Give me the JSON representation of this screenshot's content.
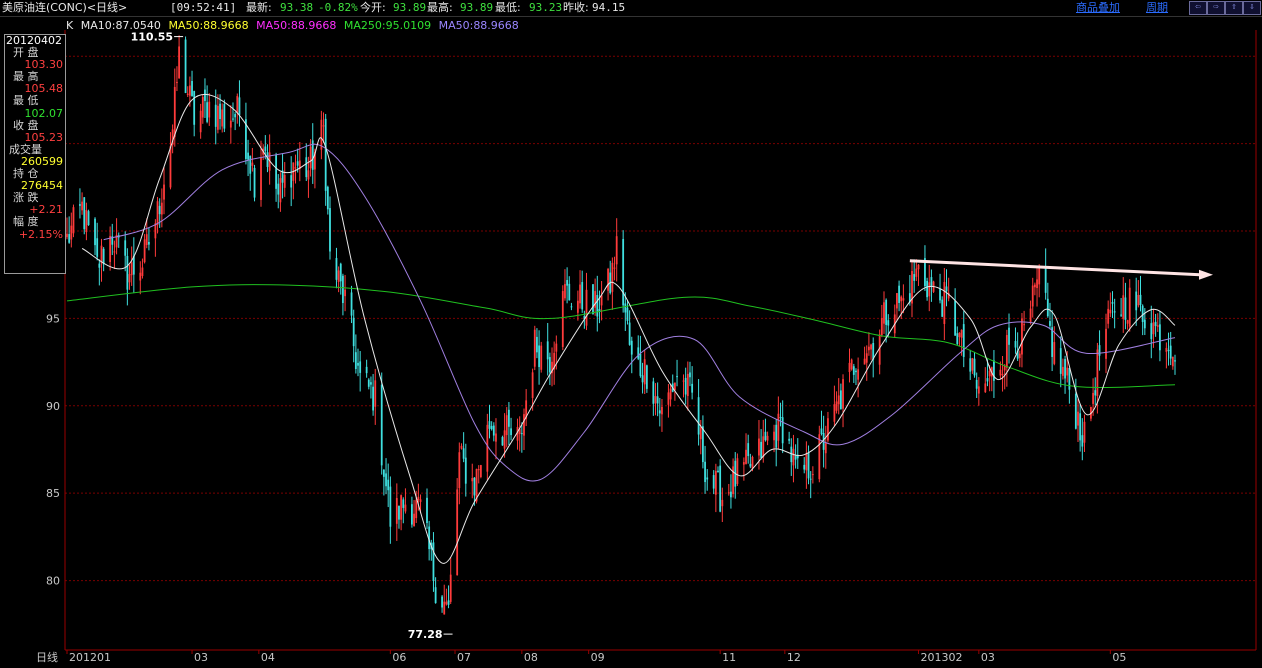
{
  "header": {
    "title": "美原油连(CONC)<日线>",
    "time": "[09:52:41]",
    "latest_label": "最新:",
    "latest_value": "93.38",
    "change": "-0.82%",
    "open_label": "今开:",
    "open_value": "93.89",
    "high_label": "最高:",
    "high_value": "93.89",
    "low_label": "最低:",
    "low_value": "93.23",
    "prev_label": "昨收:",
    "prev_value": "94.15",
    "overlay_link": "商品叠加",
    "period_link": "周期",
    "nav_buttons": [
      "⇦",
      "⇨",
      "⇧",
      "⇩"
    ]
  },
  "legend": {
    "k_label": "K",
    "ma10": "MA10:87.0540",
    "ma50a": "MA50:88.9668",
    "ma50b": "MA50:88.9668",
    "ma250": "MA250:95.0109",
    "ma50c": "MA50:88.9668"
  },
  "infobox": {
    "date": "20120402",
    "open_label": "开  盘",
    "open": "103.30",
    "high_label": "最  高",
    "high": "105.48",
    "low_label": "最  低",
    "low": "102.07",
    "close_label": "收  盘",
    "close": "105.23",
    "volume_label": "成交量",
    "volume": "260599",
    "oi_label": "持  仓",
    "oi": "276454",
    "chg_label": "涨  跌",
    "chg": "+2.21",
    "amp_label": "幅  度",
    "amp": "+2.15%"
  },
  "colors": {
    "up": "#ff3b3b",
    "down": "#3fe0e0",
    "ma10": "#e8e8e8",
    "ma50": "#a07fe0",
    "ma250": "#20c020",
    "grid": "#7a0000",
    "axis": "#9a0000",
    "trend": "#ffe4e4"
  },
  "chart_data": {
    "type": "line",
    "ylim": [
      77,
      111.5
    ],
    "yticks": [
      80,
      85,
      90,
      95
    ],
    "xlabel_prefix": "日线",
    "xticks": [
      "201201",
      "03",
      "04",
      "06",
      "07",
      "08",
      "09",
      "11",
      "12",
      "201302",
      "03",
      "05"
    ],
    "xtick_months": [
      "2012-01",
      "2012-03",
      "2012-04",
      "2012-06",
      "2012-07",
      "2012-08",
      "2012-09",
      "2012-11",
      "2012-12",
      "2013-02",
      "2013-03",
      "2013-05"
    ],
    "annotations": [
      {
        "text": "110.55",
        "date": "2012-02-24",
        "value": 110.55
      },
      {
        "text": "77.28",
        "date": "2012-06-28",
        "value": 77.28
      }
    ],
    "trendline": {
      "from": [
        "2013-01-28",
        98.3
      ],
      "to": [
        "2013-05-31",
        97.5
      ]
    },
    "price_path": [
      [
        "2012-01-03",
        99.5
      ],
      [
        "2012-01-10",
        101.3
      ],
      [
        "2012-01-17",
        98.0
      ],
      [
        "2012-01-24",
        99.8
      ],
      [
        "2012-01-31",
        97.5
      ],
      [
        "2012-02-07",
        98.2
      ],
      [
        "2012-02-14",
        101.0
      ],
      [
        "2012-02-21",
        105.8
      ],
      [
        "2012-02-24",
        110.0
      ],
      [
        "2012-03-02",
        106.5
      ],
      [
        "2012-03-09",
        107.2
      ],
      [
        "2012-03-16",
        106.4
      ],
      [
        "2012-03-23",
        106.8
      ],
      [
        "2012-03-30",
        103.0
      ],
      [
        "2012-04-03",
        105.2
      ],
      [
        "2012-04-10",
        102.0
      ],
      [
        "2012-04-17",
        103.8
      ],
      [
        "2012-04-24",
        103.5
      ],
      [
        "2012-05-01",
        105.8
      ],
      [
        "2012-05-04",
        98.5
      ],
      [
        "2012-05-11",
        96.0
      ],
      [
        "2012-05-18",
        91.5
      ],
      [
        "2012-05-25",
        90.5
      ],
      [
        "2012-06-01",
        83.5
      ],
      [
        "2012-06-08",
        84.5
      ],
      [
        "2012-06-15",
        84.0
      ],
      [
        "2012-06-22",
        79.8
      ],
      [
        "2012-06-28",
        78.2
      ],
      [
        "2012-07-03",
        87.0
      ],
      [
        "2012-07-10",
        85.5
      ],
      [
        "2012-07-17",
        89.0
      ],
      [
        "2012-07-24",
        88.5
      ],
      [
        "2012-07-31",
        88.0
      ],
      [
        "2012-08-07",
        93.5
      ],
      [
        "2012-08-14",
        92.8
      ],
      [
        "2012-08-21",
        96.5
      ],
      [
        "2012-08-28",
        96.0
      ],
      [
        "2012-09-04",
        95.5
      ],
      [
        "2012-09-11",
        97.0
      ],
      [
        "2012-09-14",
        99.0
      ],
      [
        "2012-09-21",
        92.5
      ],
      [
        "2012-09-28",
        92.0
      ],
      [
        "2012-10-05",
        89.5
      ],
      [
        "2012-10-12",
        91.8
      ],
      [
        "2012-10-19",
        90.5
      ],
      [
        "2012-10-26",
        86.0
      ],
      [
        "2012-11-02",
        84.8
      ],
      [
        "2012-11-09",
        86.0
      ],
      [
        "2012-11-16",
        86.7
      ],
      [
        "2012-11-23",
        88.0
      ],
      [
        "2012-11-30",
        88.9
      ],
      [
        "2012-12-07",
        86.0
      ],
      [
        "2012-12-14",
        86.7
      ],
      [
        "2012-12-21",
        88.5
      ],
      [
        "2012-12-28",
        90.8
      ],
      [
        "2013-01-04",
        93.0
      ],
      [
        "2013-01-11",
        93.6
      ],
      [
        "2013-01-18",
        95.6
      ],
      [
        "2013-01-25",
        96.0
      ],
      [
        "2013-02-01",
        97.8
      ],
      [
        "2013-02-08",
        96.5
      ],
      [
        "2013-02-15",
        95.8
      ],
      [
        "2013-02-22",
        93.0
      ],
      [
        "2013-03-01",
        90.7
      ],
      [
        "2013-03-08",
        91.9
      ],
      [
        "2013-03-15",
        93.5
      ],
      [
        "2013-03-22",
        94.0
      ],
      [
        "2013-03-29",
        97.2
      ],
      [
        "2013-04-05",
        93.0
      ],
      [
        "2013-04-12",
        91.0
      ],
      [
        "2013-04-19",
        88.0
      ],
      [
        "2013-04-26",
        93.0
      ],
      [
        "2013-05-03",
        95.6
      ],
      [
        "2013-05-10",
        96.0
      ],
      [
        "2013-05-17",
        95.2
      ],
      [
        "2013-05-24",
        94.1
      ],
      [
        "2013-05-31",
        93.4
      ]
    ],
    "ma250_path": [
      [
        "2012-01-03",
        96.0
      ],
      [
        "2012-03-01",
        96.8
      ],
      [
        "2012-04-15",
        96.9
      ],
      [
        "2012-06-01",
        96.5
      ],
      [
        "2012-07-15",
        95.6
      ],
      [
        "2012-08-15",
        95.0
      ],
      [
        "2012-10-15",
        96.2
      ],
      [
        "2012-11-15",
        95.7
      ],
      [
        "2012-12-15",
        94.9
      ],
      [
        "2013-01-15",
        94.0
      ],
      [
        "2013-02-15",
        93.6
      ],
      [
        "2013-03-15",
        92.2
      ],
      [
        "2013-04-15",
        91.1
      ],
      [
        "2013-05-31",
        91.2
      ]
    ],
    "ma50_path": [
      [
        "2012-01-20",
        99.5
      ],
      [
        "2012-02-15",
        100.5
      ],
      [
        "2012-03-15",
        103.5
      ],
      [
        "2012-04-15",
        104.5
      ],
      [
        "2012-05-01",
        104.8
      ],
      [
        "2012-05-20",
        102.0
      ],
      [
        "2012-06-15",
        96.0
      ],
      [
        "2012-07-10",
        89.0
      ],
      [
        "2012-07-25",
        86.5
      ],
      [
        "2012-08-10",
        85.8
      ],
      [
        "2012-08-30",
        88.5
      ],
      [
        "2012-09-25",
        93.0
      ],
      [
        "2012-10-20",
        93.8
      ],
      [
        "2012-11-10",
        90.5
      ],
      [
        "2012-12-10",
        88.5
      ],
      [
        "2012-12-28",
        87.8
      ],
      [
        "2013-01-20",
        89.5
      ],
      [
        "2013-02-20",
        93.0
      ],
      [
        "2013-03-10",
        94.6
      ],
      [
        "2013-03-31",
        94.6
      ],
      [
        "2013-04-20",
        93.0
      ],
      [
        "2013-05-31",
        93.9
      ]
    ],
    "ma10_path": [
      [
        "2012-01-10",
        99.0
      ],
      [
        "2012-01-31",
        98.0
      ],
      [
        "2012-02-15",
        103.0
      ],
      [
        "2012-03-01",
        107.5
      ],
      [
        "2012-03-20",
        107.0
      ],
      [
        "2012-04-10",
        103.5
      ],
      [
        "2012-04-25",
        104.0
      ],
      [
        "2012-05-02",
        104.8
      ],
      [
        "2012-05-20",
        95.0
      ],
      [
        "2012-06-10",
        86.0
      ],
      [
        "2012-06-25",
        81.0
      ],
      [
        "2012-07-10",
        84.5
      ],
      [
        "2012-07-30",
        88.5
      ],
      [
        "2012-08-15",
        92.0
      ],
      [
        "2012-09-05",
        96.0
      ],
      [
        "2012-09-15",
        96.8
      ],
      [
        "2012-10-05",
        92.0
      ],
      [
        "2012-10-25",
        88.5
      ],
      [
        "2012-11-10",
        86.0
      ],
      [
        "2012-11-25",
        87.5
      ],
      [
        "2012-12-10",
        87.2
      ],
      [
        "2012-12-25",
        89.0
      ],
      [
        "2013-01-15",
        93.5
      ],
      [
        "2013-02-05",
        96.8
      ],
      [
        "2013-02-25",
        95.0
      ],
      [
        "2013-03-10",
        91.5
      ],
      [
        "2013-03-25",
        94.5
      ],
      [
        "2013-04-05",
        95.2
      ],
      [
        "2013-04-20",
        89.5
      ],
      [
        "2013-05-05",
        93.5
      ],
      [
        "2013-05-20",
        95.5
      ],
      [
        "2013-05-31",
        94.6
      ]
    ]
  }
}
